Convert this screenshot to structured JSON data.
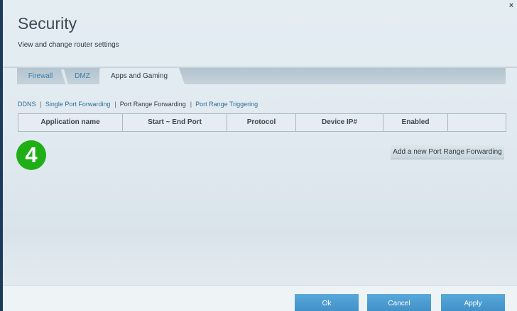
{
  "window": {
    "close_glyph": "×"
  },
  "header": {
    "title": "Security",
    "subtitle": "View and change router settings"
  },
  "tabs": [
    {
      "label": "Firewall",
      "active": false
    },
    {
      "label": "DMZ",
      "active": false
    },
    {
      "label": "Apps and Gaming",
      "active": true
    }
  ],
  "subnav": [
    {
      "label": "DDNS",
      "current": false
    },
    {
      "label": "Single Port Forwarding",
      "current": false
    },
    {
      "label": "Port Range Forwarding",
      "current": true
    },
    {
      "label": "Port Range Triggering",
      "current": false
    }
  ],
  "table": {
    "columns": [
      "Application name",
      "Start ~ End Port",
      "Protocol",
      "Device IP#",
      "Enabled",
      ""
    ]
  },
  "step_badge": "4",
  "actions": {
    "add_label": "Add a new Port Range Forwarding"
  },
  "footer": {
    "ok_label": "Ok",
    "cancel_label": "Cancel",
    "apply_label": "Apply"
  },
  "colors": {
    "accent": "#3f8fc7",
    "link": "#2e6e96",
    "step_badge": "#1fae16"
  }
}
